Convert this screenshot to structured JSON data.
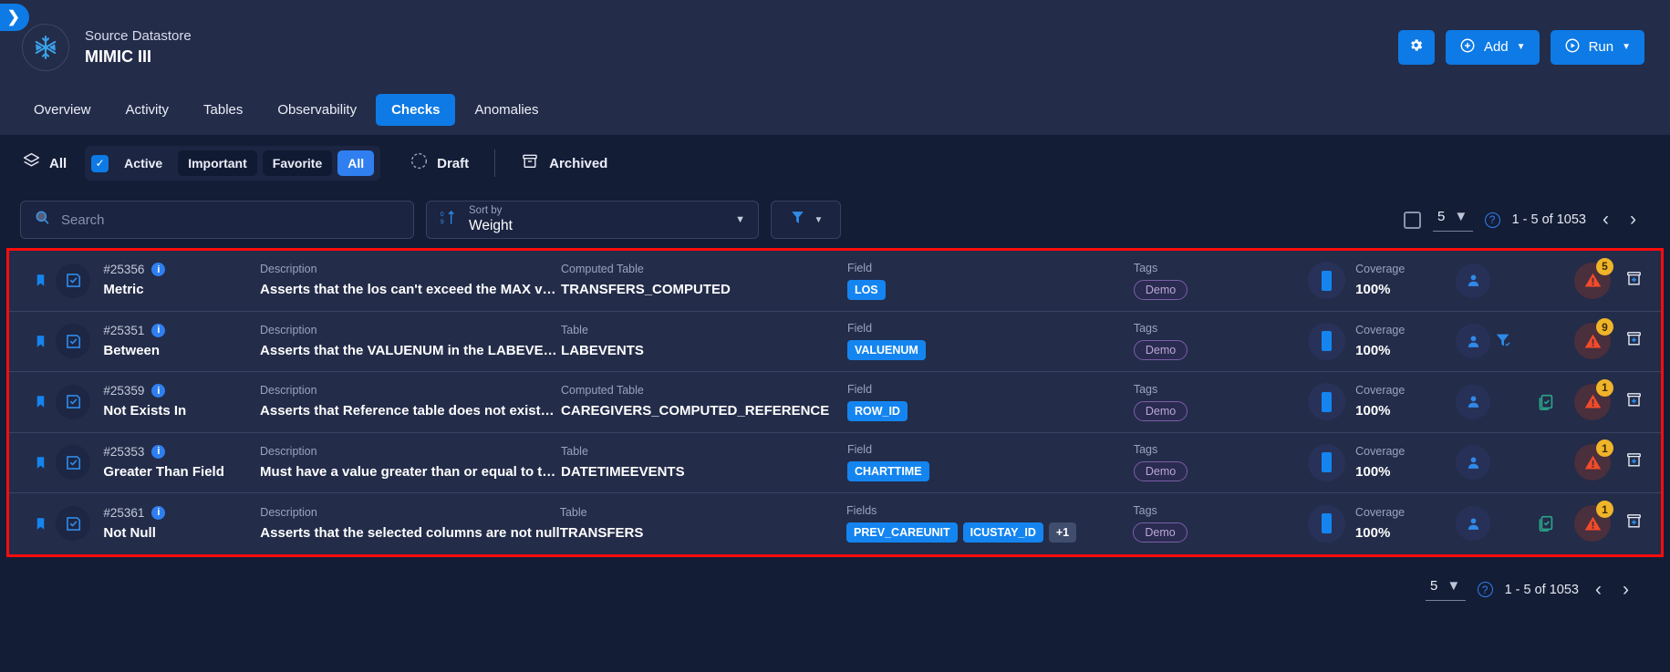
{
  "header": {
    "collapse_icon": "chevron-right-icon",
    "datastore_icon": "snowflake-icon",
    "subtitle": "Source Datastore",
    "title": "MIMIC III",
    "settings_label": "",
    "add_label": "Add",
    "run_label": "Run"
  },
  "nav": {
    "tabs": [
      {
        "label": "Overview",
        "active": false
      },
      {
        "label": "Activity",
        "active": false
      },
      {
        "label": "Tables",
        "active": false
      },
      {
        "label": "Observability",
        "active": false
      },
      {
        "label": "Checks",
        "active": true
      },
      {
        "label": "Anomalies",
        "active": false
      }
    ]
  },
  "filters": {
    "all_label": "All",
    "active_label": "Active",
    "important_label": "Important",
    "favorite_label": "Favorite",
    "all_seg_label": "All",
    "draft_label": "Draft",
    "archived_label": "Archived"
  },
  "search": {
    "placeholder": "Search",
    "value": ""
  },
  "sort": {
    "label": "Sort by",
    "value": "Weight"
  },
  "pagination": {
    "page_size": "5",
    "range_text": "1 - 5 of 1053",
    "prev_label": "‹",
    "next_label": "›"
  },
  "columns": {
    "description": "Description",
    "table": "Table",
    "computed_table": "Computed Table",
    "field": "Field",
    "fields": "Fields",
    "tags": "Tags",
    "coverage": "Coverage"
  },
  "rows": [
    {
      "id": "#25356",
      "type": "Metric",
      "desc_label": "Description",
      "description": "Asserts that the los can't exceed the MAX valu…",
      "table_label": "Computed Table",
      "table": "TRANSFERS_COMPUTED",
      "field_label": "Field",
      "fields": [
        "LOS"
      ],
      "more_fields": "",
      "tags_label": "Tags",
      "tags": [
        "Demo"
      ],
      "coverage_label": "Coverage",
      "coverage": "100%",
      "alert_count": "5",
      "has_filter_icon": false,
      "has_clipboard_icon": false
    },
    {
      "id": "#25351",
      "type": "Between",
      "desc_label": "Description",
      "description": "Asserts that the VALUENUM in the LABEVENTS…",
      "table_label": "Table",
      "table": "LABEVENTS",
      "field_label": "Field",
      "fields": [
        "VALUENUM"
      ],
      "more_fields": "",
      "tags_label": "Tags",
      "tags": [
        "Demo"
      ],
      "coverage_label": "Coverage",
      "coverage": "100%",
      "alert_count": "9",
      "has_filter_icon": true,
      "has_clipboard_icon": false
    },
    {
      "id": "#25359",
      "type": "Not Exists In",
      "desc_label": "Description",
      "description": "Asserts that Reference table does not exists i…",
      "table_label": "Computed Table",
      "table": "CAREGIVERS_COMPUTED_REFERENCE",
      "field_label": "Field",
      "fields": [
        "ROW_ID"
      ],
      "more_fields": "",
      "tags_label": "Tags",
      "tags": [
        "Demo"
      ],
      "coverage_label": "Coverage",
      "coverage": "100%",
      "alert_count": "1",
      "has_filter_icon": false,
      "has_clipboard_icon": true
    },
    {
      "id": "#25353",
      "type": "Greater Than Field",
      "desc_label": "Description",
      "description": "Must have a value greater than or equal to the …",
      "table_label": "Table",
      "table": "DATETIMEEVENTS",
      "field_label": "Field",
      "fields": [
        "CHARTTIME"
      ],
      "more_fields": "",
      "tags_label": "Tags",
      "tags": [
        "Demo"
      ],
      "coverage_label": "Coverage",
      "coverage": "100%",
      "alert_count": "1",
      "has_filter_icon": false,
      "has_clipboard_icon": false
    },
    {
      "id": "#25361",
      "type": "Not Null",
      "desc_label": "Description",
      "description": "Asserts that the selected columns are not null",
      "table_label": "Table",
      "table": "TRANSFERS",
      "field_label": "Fields",
      "fields": [
        "PREV_CAREUNIT",
        "ICUSTAY_ID"
      ],
      "more_fields": "+1",
      "tags_label": "Tags",
      "tags": [
        "Demo"
      ],
      "coverage_label": "Coverage",
      "coverage": "100%",
      "alert_count": "1",
      "has_filter_icon": false,
      "has_clipboard_icon": true
    }
  ],
  "colors": {
    "accent": "#0d7ae5",
    "chip": "#1485f0",
    "alert": "#f14b2a",
    "badge": "#f0b429",
    "tag_border": "#7a5ea8",
    "highlight_border": "#fb0c0c",
    "clipboard": "#2aa58a"
  }
}
